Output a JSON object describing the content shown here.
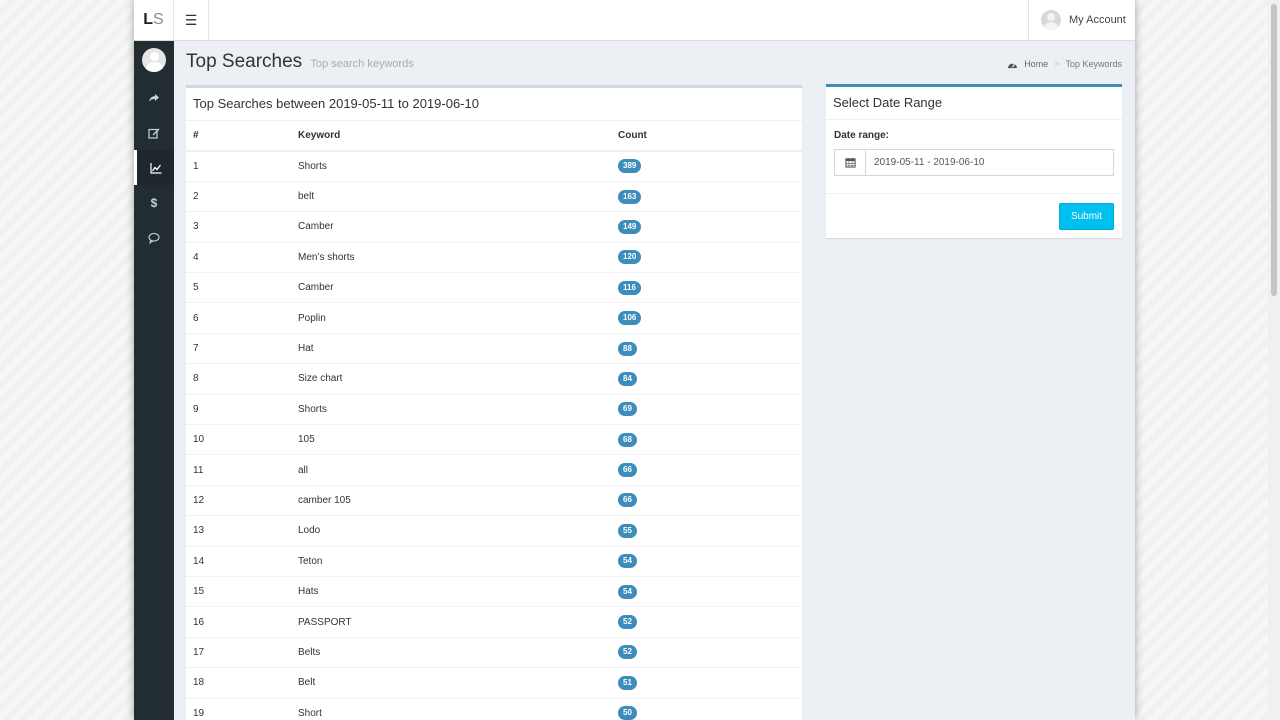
{
  "header": {
    "logo_primary": "L",
    "logo_secondary": "S",
    "menu_icon": "hamburger-icon",
    "account_label": "My Account"
  },
  "sidebar": {
    "items": [
      {
        "icon": "share-arrow-icon",
        "active": false
      },
      {
        "icon": "edit-icon",
        "active": false
      },
      {
        "icon": "line-chart-icon",
        "active": true
      },
      {
        "icon": "dollar-icon",
        "active": false
      },
      {
        "icon": "comment-icon",
        "active": false
      }
    ]
  },
  "page": {
    "title": "Top Searches",
    "subtitle": "Top search keywords"
  },
  "breadcrumb": {
    "home": "Home",
    "current": "Top Keywords"
  },
  "searches_box": {
    "title": "Top Searches between 2019-05-11 to 2019-06-10",
    "columns": [
      "#",
      "Keyword",
      "Count"
    ],
    "rows": [
      {
        "num": "1",
        "keyword": "Shorts",
        "count": "389"
      },
      {
        "num": "2",
        "keyword": "belt",
        "count": "163"
      },
      {
        "num": "3",
        "keyword": "Camber",
        "count": "149"
      },
      {
        "num": "4",
        "keyword": "Men’s shorts",
        "count": "120"
      },
      {
        "num": "5",
        "keyword": "Camber",
        "count": "116"
      },
      {
        "num": "6",
        "keyword": "Poplin",
        "count": "106"
      },
      {
        "num": "7",
        "keyword": "Hat",
        "count": "88"
      },
      {
        "num": "8",
        "keyword": "Size chart",
        "count": "84"
      },
      {
        "num": "9",
        "keyword": "Shorts",
        "count": "69"
      },
      {
        "num": "10",
        "keyword": "105",
        "count": "68"
      },
      {
        "num": "11",
        "keyword": "all",
        "count": "66"
      },
      {
        "num": "12",
        "keyword": "camber 105",
        "count": "66"
      },
      {
        "num": "13",
        "keyword": "Lodo",
        "count": "55"
      },
      {
        "num": "14",
        "keyword": "Teton",
        "count": "54"
      },
      {
        "num": "15",
        "keyword": "Hats",
        "count": "54"
      },
      {
        "num": "16",
        "keyword": "PASSPORT",
        "count": "52"
      },
      {
        "num": "17",
        "keyword": "Belts",
        "count": "52"
      },
      {
        "num": "18",
        "keyword": "Belt",
        "count": "51"
      },
      {
        "num": "19",
        "keyword": "Short",
        "count": "50"
      }
    ]
  },
  "date_box": {
    "title": "Select Date Range",
    "label": "Date range:",
    "value": "2019-05-11 - 2019-06-10",
    "submit_label": "Submit"
  },
  "colors": {
    "sidebar_bg": "#222d32",
    "badge": "#3c8dbc",
    "submit": "#00c0ef",
    "content_bg": "#ecf0f5"
  }
}
